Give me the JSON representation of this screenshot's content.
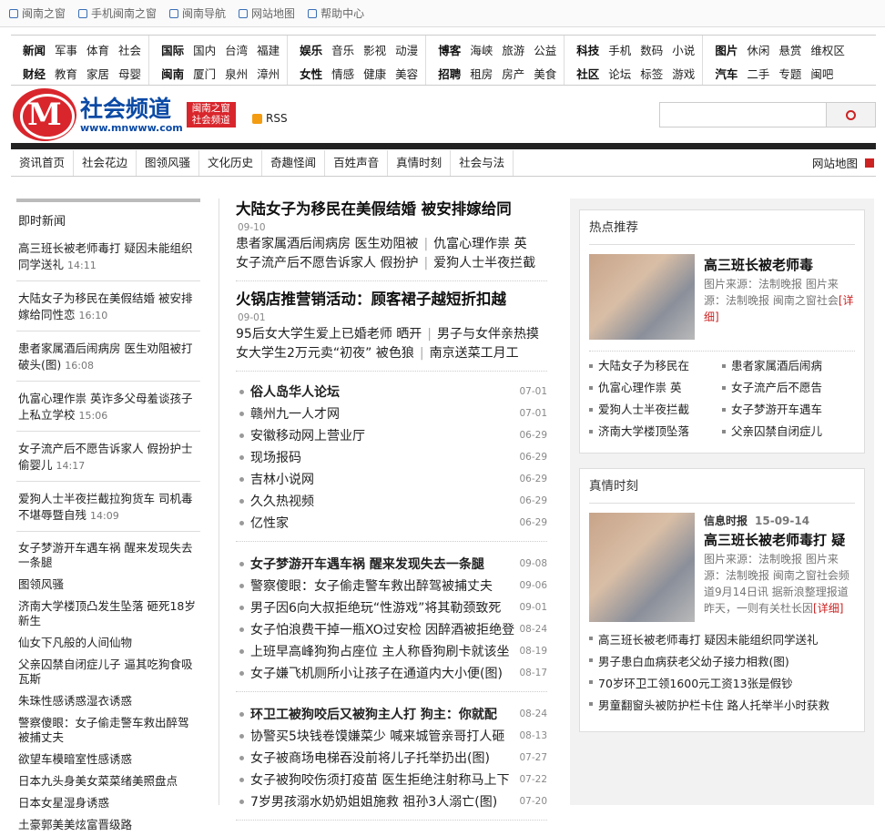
{
  "topbar": [
    "闽南之窗",
    "手机闽南之窗",
    "闽南导航",
    "网站地图",
    "帮助中心"
  ],
  "channels": [
    [
      [
        "新闻",
        "军事",
        "体育",
        "社会"
      ],
      [
        "财经",
        "教育",
        "家居",
        "母婴"
      ]
    ],
    [
      [
        "国际",
        "国内",
        "台湾",
        "福建"
      ],
      [
        "闽南",
        "厦门",
        "泉州",
        "漳州"
      ]
    ],
    [
      [
        "娱乐",
        "音乐",
        "影视",
        "动漫"
      ],
      [
        "女性",
        "情感",
        "健康",
        "美容"
      ]
    ],
    [
      [
        "博客",
        "海峡",
        "旅游",
        "公益"
      ],
      [
        "招聘",
        "租房",
        "房产",
        "美食"
      ]
    ],
    [
      [
        "科技",
        "手机",
        "数码",
        "小说"
      ],
      [
        "社区",
        "论坛",
        "标签",
        "游戏"
      ]
    ],
    [
      [
        "图片",
        "休闲",
        "悬赏",
        "维权区"
      ],
      [
        "汽车",
        "二手",
        "专题",
        "闽吧"
      ]
    ]
  ],
  "logo": {
    "name": "社会频道",
    "url": "www.mnwww.com",
    "tag": "闽南之窗社会频道"
  },
  "rss": "RSS",
  "nav": [
    "资讯首页",
    "社会花边",
    "图领风骚",
    "文化历史",
    "奇趣怪闻",
    "百姓声音",
    "真情时刻",
    "社会与法"
  ],
  "nav_sitemap": "网站地图",
  "left": {
    "title": "即时新闻",
    "items": [
      {
        "t": "高三班长被老师毒打  疑因未能组织同学送礼",
        "time": "14:11"
      },
      {
        "t": "大陆女子为移民在美假结婚 被安排嫁给同性恋",
        "time": "16:10"
      },
      {
        "t": "患者家属酒后闹病房 医生劝阻被打破头(图)",
        "time": "16:08"
      },
      {
        "t": "仇富心理作祟 英诈多父母羞谈孩子上私立学校",
        "time": "15:06"
      },
      {
        "t": "女子流产后不愿告诉家人 假扮护士偷婴儿",
        "time": "14:17"
      },
      {
        "t": "爱狗人士半夜拦截拉狗货车 司机毒不堪辱暨自残",
        "time": "14:09"
      }
    ],
    "plain": [
      "女子梦游开车遇车祸 醒来发现失去一条腿",
      "图领风骚",
      "济南大学楼顶凸发生坠落 砸死18岁新生",
      "仙女下凡般的人间仙物",
      "父亲囚禁自闭症儿子 逼其吃狗食吸瓦斯",
      "朱珠性感诱惑湿衣诱惑",
      "警察傻眼：女子偷走警车救出醉驾被捕丈夫",
      "欲望车模暗室性感诱惑",
      "日本九头身美女菜菜绪美照盘点",
      "日本女星湿身诱惑",
      "土豪郭美美炫富晋级路"
    ]
  },
  "main": {
    "headlines": [
      {
        "title": "大陆女子为移民在美假结婚 被安排嫁给同",
        "date": "09-10",
        "lines": [
          [
            "患者家属酒后闹病房 医生劝阻被",
            "仇富心理作祟 英"
          ],
          [
            "女子流产后不愿告诉家人 假扮护",
            "爱狗人士半夜拦截"
          ]
        ]
      },
      {
        "title": "火锅店推营销活动：顾客裙子越短折扣越",
        "date": "09-01",
        "lines": [
          [
            "95后女大学生爱上已婚老师 晒开",
            "男子与女伴亲热摸"
          ],
          [
            "女大学生2万元卖“初夜” 被色狼",
            "南京送菜工月工"
          ]
        ]
      }
    ],
    "lists": [
      [
        [
          "俗人岛华人论坛",
          "07-01"
        ],
        [
          "赣州九一人才网",
          "07-01"
        ],
        [
          "安徽移动网上营业厅",
          "06-29"
        ],
        [
          "现场报码",
          "06-29"
        ],
        [
          "吉林小说网",
          "06-29"
        ],
        [
          "久久热视频",
          "06-29"
        ],
        [
          "亿性家",
          "06-29"
        ]
      ],
      [
        [
          "女子梦游开车遇车祸 醒来发现失去一条腿",
          "09-08"
        ],
        [
          "警察傻眼：女子偷走警车救出醉驾被捕丈夫",
          "09-06"
        ],
        [
          "男子因6向大叔拒绝玩“性游戏”将其勒颈致死",
          "09-01"
        ],
        [
          "女子怕浪费干掉一瓶XO过安检 因醉酒被拒绝登",
          "08-24"
        ],
        [
          "上班早高峰狗狗占座位 主人称昏狗刷卡就该坐",
          "08-19"
        ],
        [
          "女子嫌飞机厕所小让孩子在通道内大小便(图)",
          "08-17"
        ]
      ],
      [
        [
          "环卫工被狗咬后又被狗主人打 狗主：你就配",
          "08-24"
        ],
        [
          "协警买5块钱卷馍嫌菜少 喊来城管亲哥打人砸",
          "08-13"
        ],
        [
          "女子被商场电梯吞没前将儿子托举扔出(图)",
          "07-27"
        ],
        [
          "女子被狗咬伤须打疫苗 医生拒绝注射称马上下",
          "07-22"
        ],
        [
          "7岁男孩溺水奶奶姐姐施救 祖孙3人溺亡(图)",
          "07-20"
        ]
      ]
    ]
  },
  "right": {
    "hot": {
      "title": "热点推荐",
      "feat_title": "高三班长被老师毒",
      "feat_desc": "图片来源：法制晚报 图片来源：法制晚报 闽南之窗社会",
      "more": "[详细]",
      "grid": [
        "大陆女子为移民在",
        "患者家属酒后闹病",
        "仇富心理作祟 英",
        "女子流产后不愿告",
        "爱狗人士半夜拦截",
        "女子梦游开车遇车",
        "济南大学楼顶坠落",
        "父亲囚禁自闭症儿"
      ]
    },
    "true": {
      "title": "真情时刻",
      "src": "信息时报",
      "date": "15-09-14",
      "feat_title": "高三班长被老师毒打 疑",
      "feat_desc": "图片来源：法制晚报 图片来源：法制晚报 闽南之窗社会频道9月14日讯 据新浪整理报道 昨天，一则有关杜长因",
      "more": "[详细]",
      "list": [
        "高三班长被老师毒打 疑因未能组织同学送礼",
        "男子患白血病获老父幼子接力相救(图)",
        "70岁环卫工领1600元工资13张是假钞",
        "男童翻窗头被防护栏卡住 路人托举半小时获救"
      ]
    }
  }
}
